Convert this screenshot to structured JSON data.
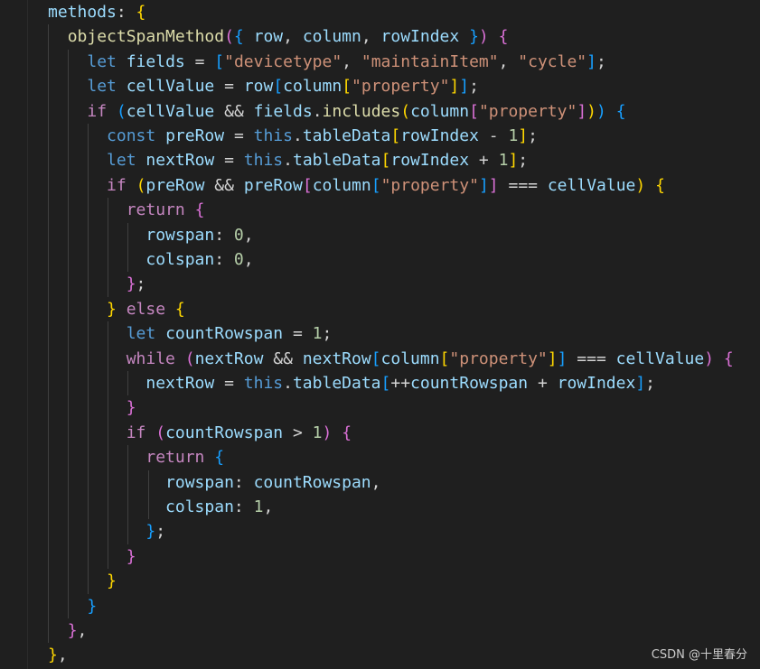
{
  "editor": {
    "language": "javascript",
    "theme": "dark",
    "colors": {
      "background": "#1f1f1f",
      "keyword": "#569cd6",
      "control": "#c586c0",
      "variable": "#9cdcfe",
      "function": "#dcdcaa",
      "string": "#ce9178",
      "number": "#b5cea8",
      "operator": "#d4d4d4",
      "bracket_level_1": "#ffd700",
      "bracket_level_2": "#da70d6",
      "bracket_level_3": "#179fff"
    },
    "lines": [
      "methods: {",
      "  objectSpanMethod({ row, column, rowIndex }) {",
      "    let fields = [\"devicetype\", \"maintainItem\", \"cycle\"];",
      "    let cellValue = row[column[\"property\"]];",
      "    if (cellValue && fields.includes(column[\"property\"])) {",
      "      const preRow = this.tableData[rowIndex - 1];",
      "      let nextRow = this.tableData[rowIndex + 1];",
      "      if (preRow && preRow[column[\"property\"]] === cellValue) {",
      "        return {",
      "          rowspan: 0,",
      "          colspan: 0,",
      "        };",
      "      } else {",
      "        let countRowspan = 1;",
      "        while (nextRow && nextRow[column[\"property\"]] === cellValue) {",
      "          nextRow = this.tableData[++countRowspan + rowIndex];",
      "        }",
      "        if (countRowspan > 1) {",
      "          return {",
      "            rowspan: countRowspan,",
      "            colspan: 1,",
      "          };",
      "        }",
      "      }",
      "    }",
      "  },",
      "},"
    ]
  },
  "watermark": "CSDN @十里春分"
}
